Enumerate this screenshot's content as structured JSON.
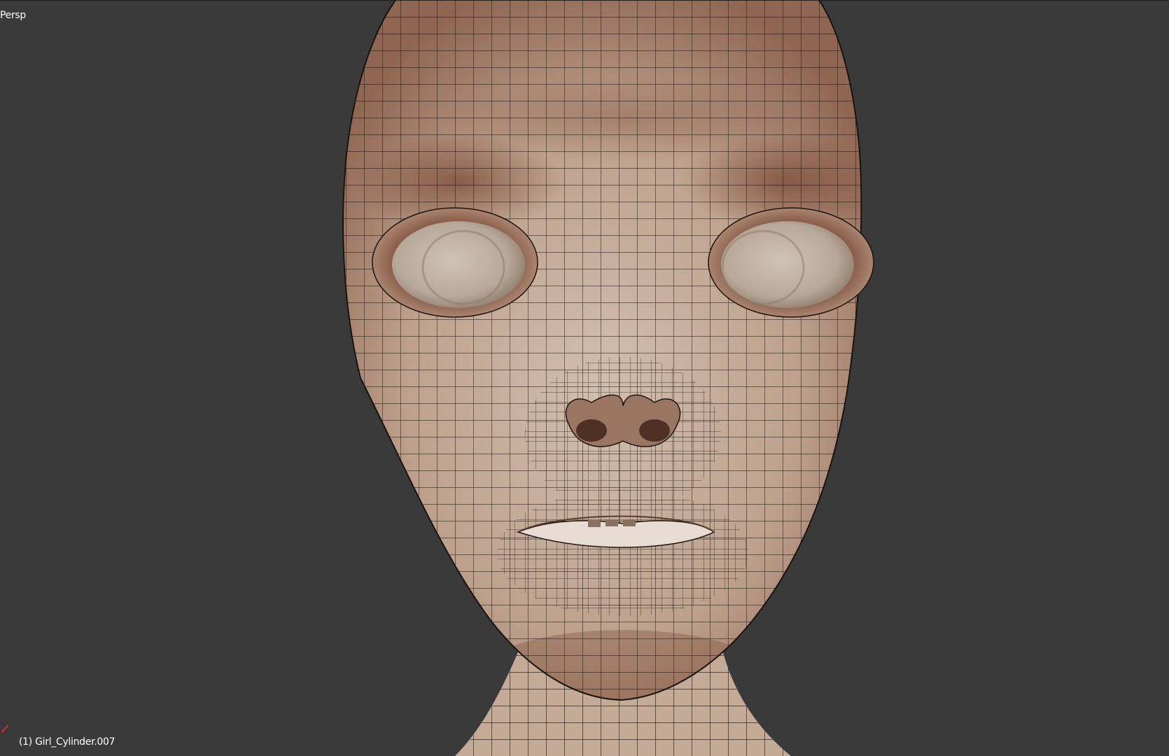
{
  "viewport": {
    "view_label": "Persp",
    "object_label": "(1) Girl_Cylinder.007",
    "background_color": "#3a3a3a"
  },
  "mesh": {
    "skin_color": "#c9b3a2",
    "shadow_color": "#6e4330",
    "wire_color": "#1a1410",
    "eye_color": "#c7b9ac"
  },
  "gizmo": {
    "x_axis_color": "#d03030"
  }
}
